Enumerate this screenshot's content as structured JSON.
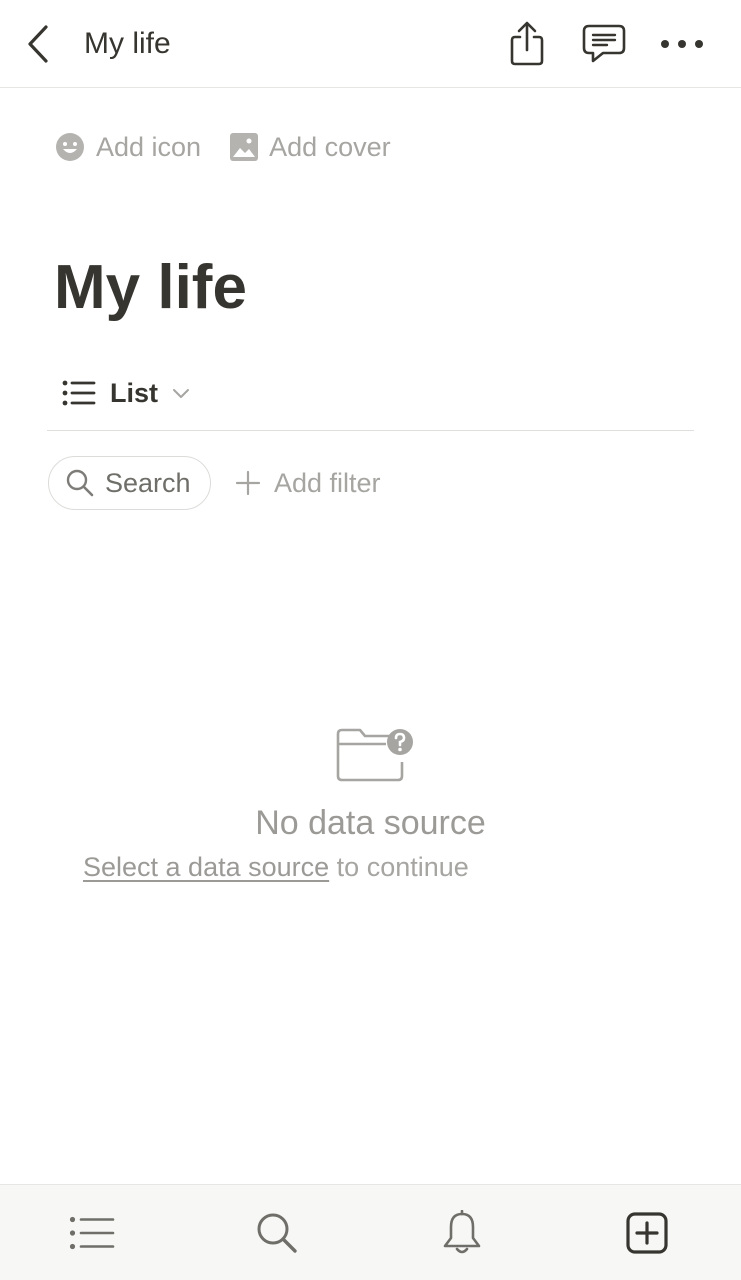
{
  "header": {
    "title": "My life",
    "back_icon": "chevron-left-icon",
    "share_icon": "share-icon",
    "comment_icon": "comment-icon",
    "more_icon": "more-horizontal-icon"
  },
  "page_meta": {
    "add_icon_label": "Add icon",
    "add_cover_label": "Add cover"
  },
  "page": {
    "title": "My life"
  },
  "view": {
    "label": "List",
    "icon": "list-icon"
  },
  "toolbar": {
    "search_label": "Search",
    "add_filter_label": "Add filter"
  },
  "empty_state": {
    "title": "No data source",
    "link_text": "Select a data source",
    "suffix_text": "to continue"
  },
  "bottom_nav": {
    "items": [
      "list-icon",
      "search-icon",
      "bell-icon",
      "new-page-icon"
    ]
  },
  "colors": {
    "text": "#37352f",
    "muted": "#a6a5a2",
    "divider": "#e6e6e4",
    "bottom_bar": "#f7f7f5"
  }
}
